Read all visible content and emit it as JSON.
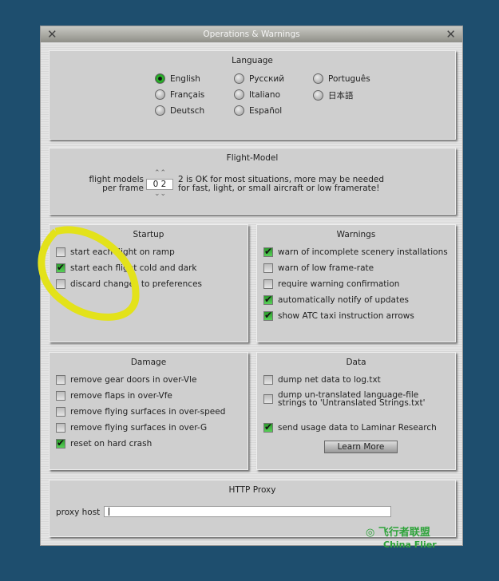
{
  "window": {
    "title": "Operations & Warnings"
  },
  "language": {
    "title": "Language",
    "options": [
      {
        "label": "English",
        "selected": true
      },
      {
        "label": "Français",
        "selected": false
      },
      {
        "label": "Deutsch",
        "selected": false
      },
      {
        "label": "Русский",
        "selected": false
      },
      {
        "label": "Italiano",
        "selected": false
      },
      {
        "label": "Español",
        "selected": false
      },
      {
        "label": "Português",
        "selected": false
      },
      {
        "label": "日本語",
        "selected": false
      }
    ]
  },
  "flight_model": {
    "title": "Flight-Model",
    "label1": "flight models",
    "label2": "per frame",
    "value": "0 2",
    "note1": "2 is OK for most situations, more may be needed",
    "note2": "for fast, light, or small aircraft or low framerate!"
  },
  "startup": {
    "title": "Startup",
    "items": [
      {
        "label": "start each flight on ramp",
        "checked": false
      },
      {
        "label": "start each flight cold and dark",
        "checked": true
      },
      {
        "label": "discard changes to preferences",
        "checked": false
      }
    ]
  },
  "warnings": {
    "title": "Warnings",
    "items": [
      {
        "label": "warn of incomplete scenery installations",
        "checked": true
      },
      {
        "label": "warn of low frame-rate",
        "checked": false
      },
      {
        "label": "require warning confirmation",
        "checked": false
      },
      {
        "label": "automatically notify of updates",
        "checked": true
      },
      {
        "label": "show ATC taxi instruction arrows",
        "checked": true
      }
    ]
  },
  "damage": {
    "title": "Damage",
    "items": [
      {
        "label": "remove gear doors in over-Vle",
        "checked": false
      },
      {
        "label": "remove flaps in over-Vfe",
        "checked": false
      },
      {
        "label": "remove flying surfaces in over-speed",
        "checked": false
      },
      {
        "label": "remove flying surfaces in over-G",
        "checked": false
      },
      {
        "label": "reset on hard crash",
        "checked": true
      }
    ]
  },
  "data": {
    "title": "Data",
    "items": [
      {
        "label": "dump net data to log.txt",
        "checked": false
      },
      {
        "label": "dump un-translated language-file",
        "label2": "strings to 'Untranslated Strings.txt'",
        "checked": false
      },
      {
        "label": "send usage data to Laminar Research",
        "checked": true
      }
    ],
    "learn_more": "Learn More"
  },
  "proxy": {
    "title": "HTTP Proxy",
    "label": "proxy host",
    "value": ""
  },
  "watermark": {
    "text": "飞行者联盟",
    "sub": "China Flier"
  }
}
